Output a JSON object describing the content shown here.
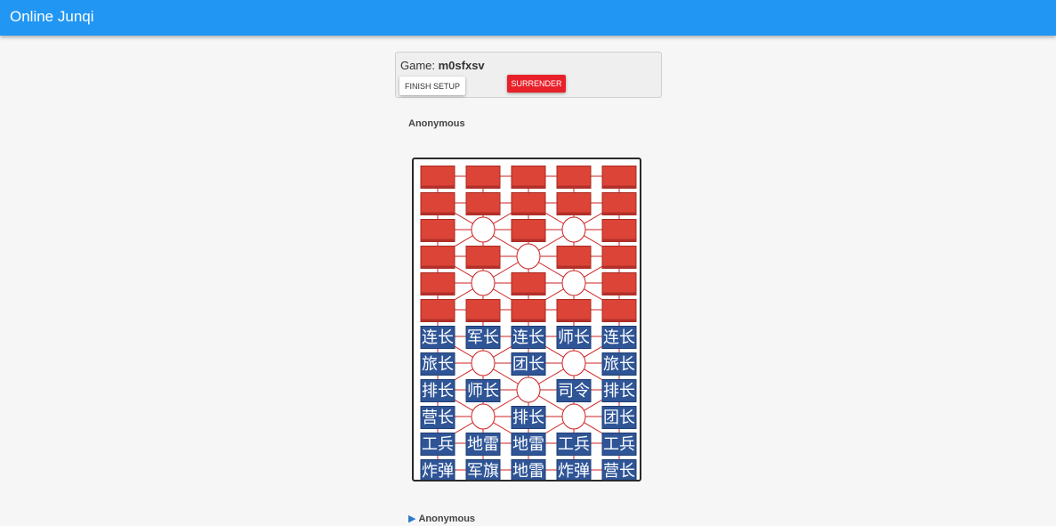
{
  "app": {
    "title": "Online Junqi"
  },
  "game": {
    "label": "Game: ",
    "id": "m0sfxsv",
    "finish_setup_label": "FINISH SETUP",
    "surrender_label": "SURRENDER"
  },
  "players": {
    "top_name": "Anonymous",
    "bottom_name": "Anonymous"
  },
  "colors": {
    "appbar": "#2196f3",
    "enemy_piece": "#db4437",
    "own_piece": "#2f5597",
    "rail_line": "#cc2222",
    "surrender": "#e8202a"
  },
  "board": {
    "enemy_cells": [
      [
        1,
        1,
        1,
        1,
        1
      ],
      [
        1,
        1,
        1,
        1,
        1
      ],
      [
        1,
        0,
        1,
        0,
        1
      ],
      [
        1,
        1,
        0,
        1,
        1
      ],
      [
        1,
        0,
        1,
        0,
        1
      ],
      [
        1,
        1,
        1,
        1,
        1
      ]
    ],
    "own_pieces": [
      [
        "连长",
        "军长",
        "连长",
        "师长",
        "连长"
      ],
      [
        "旅长",
        "",
        "团长",
        "",
        "旅长"
      ],
      [
        "排长",
        "师长",
        "",
        "司令",
        "排长"
      ],
      [
        "营长",
        "",
        "排长",
        "",
        "团长"
      ],
      [
        "工兵",
        "地雷",
        "地雷",
        "工兵",
        "工兵"
      ],
      [
        "炸弹",
        "军旗",
        "地雷",
        "炸弹",
        "营长"
      ]
    ],
    "camps": [
      [
        2,
        1
      ],
      [
        2,
        3
      ],
      [
        3,
        2
      ],
      [
        4,
        1
      ],
      [
        4,
        3
      ],
      [
        7,
        1
      ],
      [
        7,
        3
      ],
      [
        8,
        2
      ],
      [
        9,
        1
      ],
      [
        9,
        3
      ]
    ]
  }
}
